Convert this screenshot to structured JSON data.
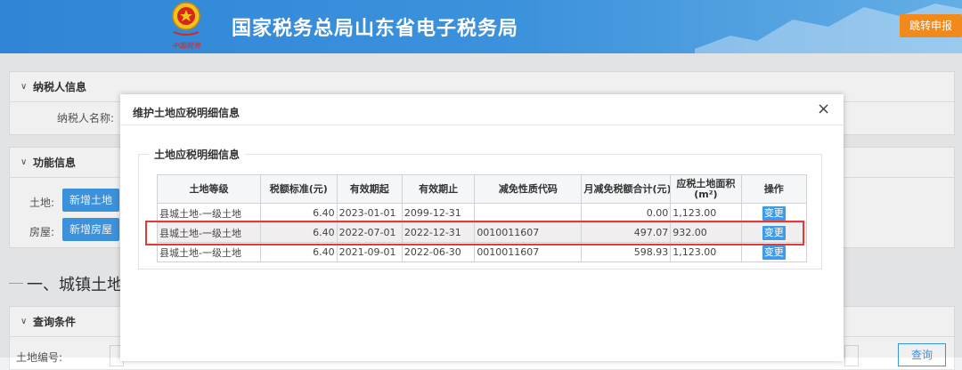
{
  "header": {
    "site_title": "国家税务总局山东省电子税务局",
    "emblem_caption": "中国税务",
    "jump_button": "跳转申报"
  },
  "background": {
    "taxpayer_panel_title": "纳税人信息",
    "taxpayer_name_label": "纳税人名称:",
    "function_panel_title": "功能信息",
    "land_label": "土地:",
    "add_land_button": "新增土地",
    "house_label": "房屋:",
    "add_house_button": "新增房屋",
    "section_title": "一、城镇土地使",
    "query_panel_title": "查询条件",
    "land_no_label": "土地编号:",
    "query_button": "查询"
  },
  "modal": {
    "title": "维护土地应税明细信息",
    "close_icon": "×",
    "fieldset_legend": "土地应税明细信息",
    "columns": [
      "土地等级",
      "税额标准(元)",
      "有效期起",
      "有效期止",
      "减免性质代码",
      "月减免税额合计(元)",
      "应税土地面积(m²)",
      "操作"
    ],
    "rows": [
      {
        "grade": "县城土地-一级土地",
        "rate": "6.40",
        "start": "2023-01-01",
        "end": "2099-12-31",
        "code": "",
        "relief": "0.00",
        "area": "1,123.00",
        "action": "变更"
      },
      {
        "grade": "县城土地-一级土地",
        "rate": "6.40",
        "start": "2022-07-01",
        "end": "2022-12-31",
        "code": "0010011607",
        "relief": "497.07",
        "area": "932.00",
        "action": "变更"
      },
      {
        "grade": "县城土地-一级土地",
        "rate": "6.40",
        "start": "2021-09-01",
        "end": "2022-06-30",
        "code": "0010011607",
        "relief": "598.93",
        "area": "1,123.00",
        "action": "变更"
      }
    ]
  },
  "colors": {
    "header_blue": "#2f86d6",
    "accent_orange": "#f08a1c",
    "button_blue": "#3f9be8",
    "highlight_red": "#e53936"
  }
}
